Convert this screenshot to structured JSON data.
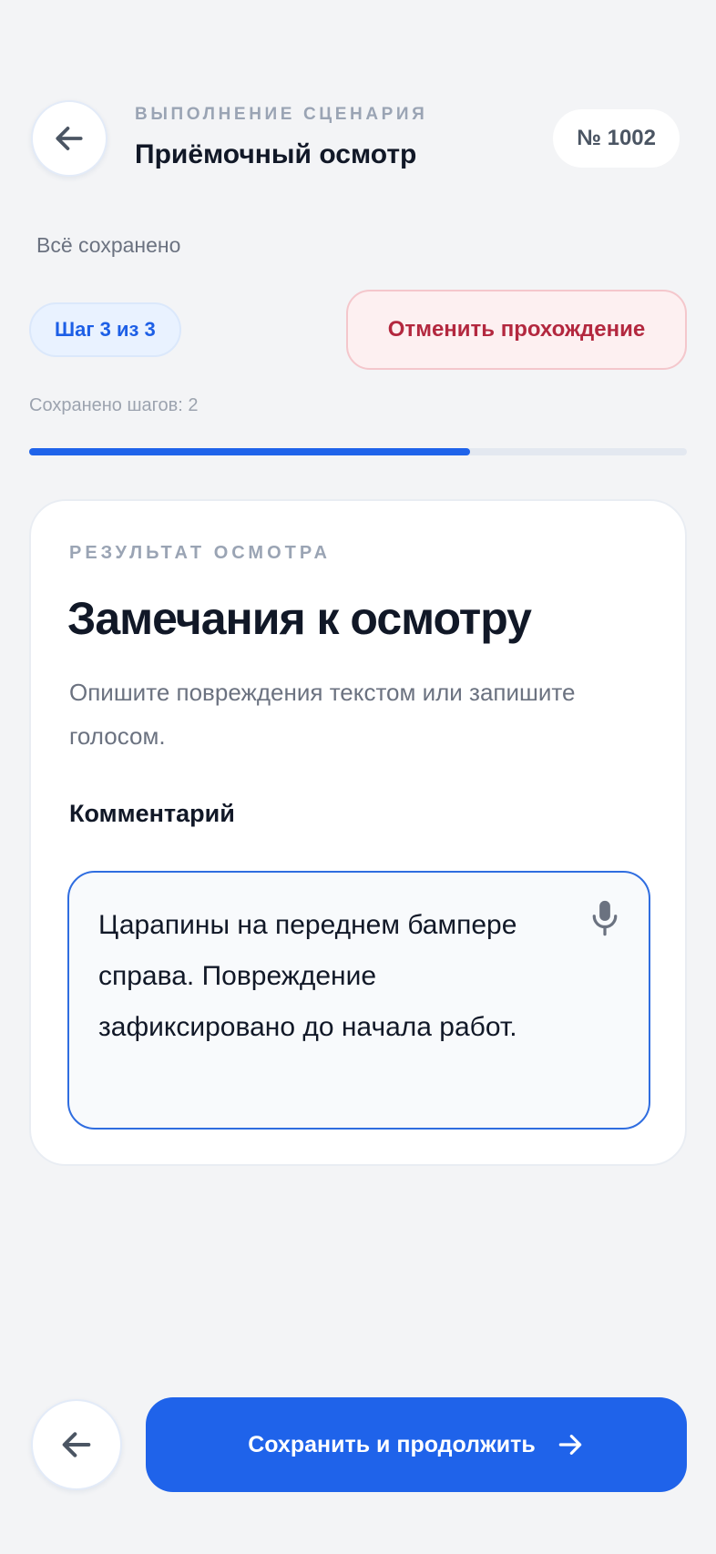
{
  "header": {
    "eyebrow": "ВЫПОЛНЕНИЕ СЦЕНАРИЯ",
    "title": "Приёмочный осмотр",
    "number": "№ 1002"
  },
  "status": {
    "saved_text": "Всё сохранено",
    "step_label": "Шаг 3 из 3",
    "cancel_label": "Отменить прохождение",
    "saved_steps_text": "Сохранено шагов: 2",
    "progress_fraction": 0.67
  },
  "card": {
    "eyebrow": "РЕЗУЛЬТАТ ОСМОТРА",
    "title": "Замечания к осмотру",
    "description": "Опишите повреждения текстом или запишите голосом.",
    "field_label": "Комментарий",
    "comment_value": "Царапины на переднем бампере справа. Повреждение зафиксировано до начала работ."
  },
  "footer": {
    "primary_label": "Сохранить и продолжить"
  },
  "icons": {
    "back": "arrow-left-icon",
    "mic": "microphone-icon",
    "forward": "arrow-right-icon"
  },
  "colors": {
    "accent": "#1f63ea",
    "danger": "#b3283f",
    "background": "#f3f4f6"
  }
}
